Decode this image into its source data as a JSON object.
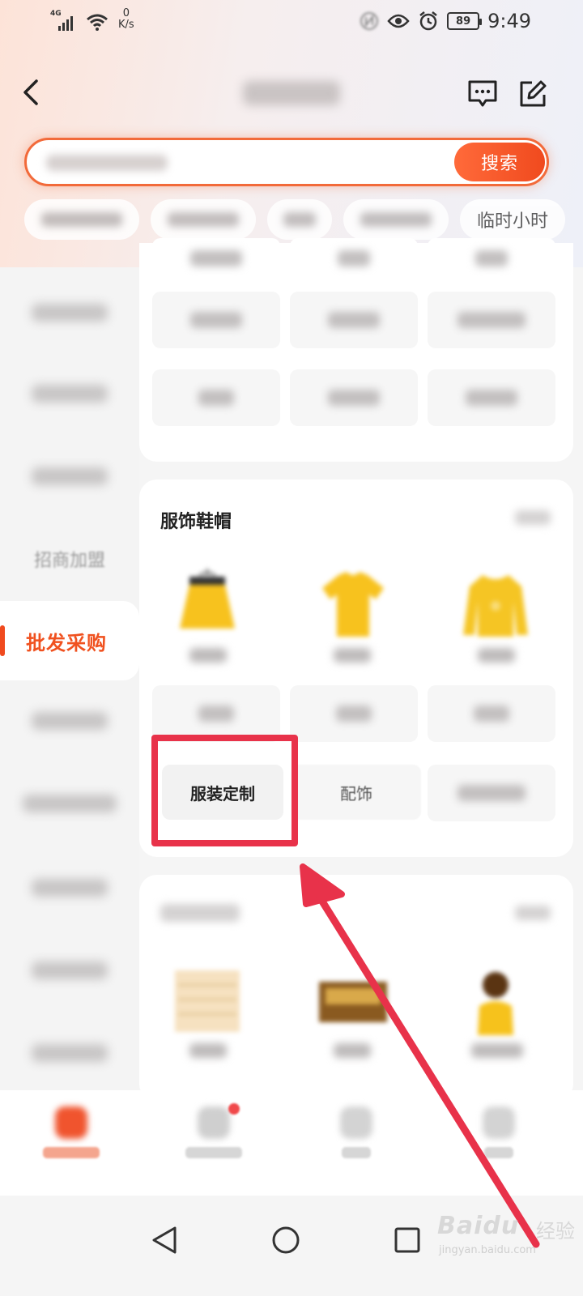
{
  "status_bar": {
    "network": "4G",
    "speed_value": "0",
    "speed_unit": "K/s",
    "battery": "89",
    "time": "9:49"
  },
  "search": {
    "button_label": "搜索"
  },
  "chips": {
    "last_visible": "临时小时"
  },
  "sidebar": {
    "active_label": "批发采购",
    "soft_label": "招商加盟"
  },
  "section": {
    "title": "服饰鞋帽",
    "highlighted_item": "服装定制",
    "second_item": "配饰"
  },
  "colors": {
    "accent": "#f04a1e",
    "annotation_red": "#e8324a"
  },
  "watermark": {
    "brand": "Baidu",
    "cn": "经验",
    "url": "jingyan.baidu.com"
  },
  "icons": [
    "back-icon",
    "message-icon",
    "edit-icon",
    "search-icon",
    "home-icon",
    "back-triangle-icon",
    "home-circle-icon",
    "recents-square-icon"
  ]
}
